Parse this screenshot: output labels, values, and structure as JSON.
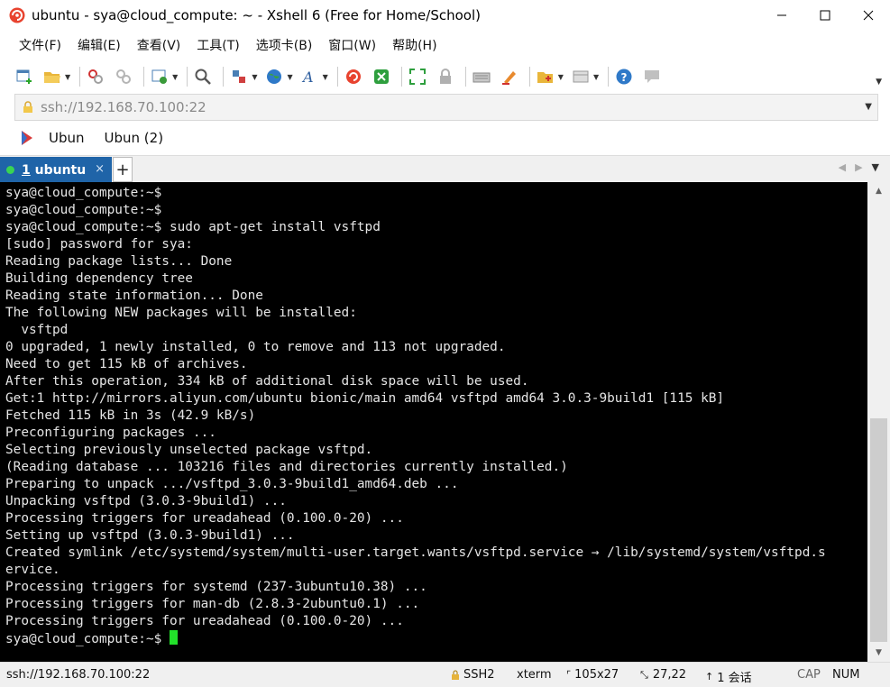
{
  "window": {
    "title": "ubuntu - sya@cloud_compute: ~ - Xshell 6 (Free for Home/School)",
    "app_icon": "xshell-icon",
    "controls": [
      "minimize-icon",
      "maximize-icon",
      "close-icon"
    ]
  },
  "menu": {
    "items": [
      "文件(F)",
      "编辑(E)",
      "查看(V)",
      "工具(T)",
      "选项卡(B)",
      "窗口(W)",
      "帮助(H)"
    ]
  },
  "toolbar": {
    "icons": [
      "new-session-icon",
      "open-folder-icon",
      "reconnect-icon",
      "disconnect-icon",
      "properties-icon",
      "search-icon",
      "transfer-icon",
      "globe-icon",
      "font-icon",
      "xshell-icon",
      "xftp-icon",
      "fullscreen-icon",
      "lock-icon",
      "keyboard-icon",
      "highlight-icon",
      "compose-icon",
      "layout-icon",
      "help-icon",
      "chat-icon"
    ]
  },
  "address": {
    "value": "ssh://192.168.70.100:22"
  },
  "links": {
    "items": [
      "Ubun",
      "Ubun (2)"
    ]
  },
  "tabs": {
    "active_number": "1",
    "active_name": " ubuntu",
    "close": "×",
    "add": "+"
  },
  "terminal": {
    "lines": [
      "sya@cloud_compute:~$",
      "sya@cloud_compute:~$",
      "sya@cloud_compute:~$ sudo apt-get install vsftpd",
      "[sudo] password for sya:",
      "Reading package lists... Done",
      "Building dependency tree",
      "Reading state information... Done",
      "The following NEW packages will be installed:",
      "  vsftpd",
      "0 upgraded, 1 newly installed, 0 to remove and 113 not upgraded.",
      "Need to get 115 kB of archives.",
      "After this operation, 334 kB of additional disk space will be used.",
      "Get:1 http://mirrors.aliyun.com/ubuntu bionic/main amd64 vsftpd amd64 3.0.3-9build1 [115 kB]",
      "Fetched 115 kB in 3s (42.9 kB/s)",
      "Preconfiguring packages ...",
      "Selecting previously unselected package vsftpd.",
      "(Reading database ... 103216 files and directories currently installed.)",
      "Preparing to unpack .../vsftpd_3.0.3-9build1_amd64.deb ...",
      "Unpacking vsftpd (3.0.3-9build1) ...",
      "Processing triggers for ureadahead (0.100.0-20) ...",
      "Setting up vsftpd (3.0.3-9build1) ...",
      "Created symlink /etc/systemd/system/multi-user.target.wants/vsftpd.service → /lib/systemd/system/vsftpd.s",
      "ervice.",
      "Processing triggers for systemd (237-3ubuntu10.38) ...",
      "Processing triggers for man-db (2.8.3-2ubuntu0.1) ...",
      "Processing triggers for ureadahead (0.100.0-20) ..."
    ],
    "prompt": "sya@cloud_compute:~$ ",
    "cursor_color": "#22e02a"
  },
  "status": {
    "address": "ssh://192.168.70.100:22",
    "protocol": "SSH2",
    "terminal_type": "xterm",
    "size": "105x27",
    "position": "27,22",
    "sessions": "1 会话",
    "cap": "CAP",
    "num": "NUM"
  },
  "colors": {
    "tab_active_bg": "#1f64a8",
    "terminal_bg": "#000000",
    "terminal_fg": "#e5e5e5"
  }
}
